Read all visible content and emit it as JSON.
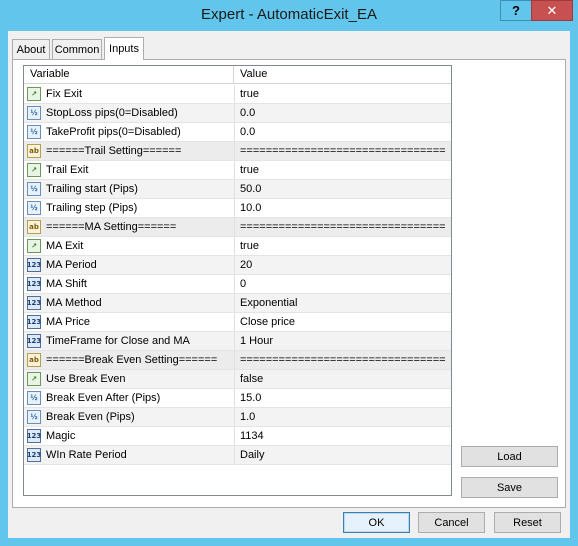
{
  "window": {
    "title": "Expert - AutomaticExit_EA",
    "help_label": "?",
    "close_label": "✕"
  },
  "tabs": [
    {
      "label": "About"
    },
    {
      "label": "Common"
    },
    {
      "label": "Inputs"
    }
  ],
  "grid": {
    "headers": {
      "variable": "Variable",
      "value": "Value"
    },
    "rows": [
      {
        "name": "Fix Exit",
        "value": "true",
        "type": "bool"
      },
      {
        "name": "StopLoss pips(0=Disabled)",
        "value": "0.0",
        "type": "double"
      },
      {
        "name": "TakeProfit pips(0=Disabled)",
        "value": "0.0",
        "type": "double"
      },
      {
        "name": "======Trail Setting======",
        "value": "================================",
        "type": "string"
      },
      {
        "name": "Trail Exit",
        "value": "true",
        "type": "bool"
      },
      {
        "name": "Trailing start (Pips)",
        "value": "50.0",
        "type": "double"
      },
      {
        "name": "Trailing step (Pips)",
        "value": "10.0",
        "type": "double"
      },
      {
        "name": "======MA Setting======",
        "value": "================================",
        "type": "string"
      },
      {
        "name": "MA Exit",
        "value": "true",
        "type": "bool"
      },
      {
        "name": "MA Period",
        "value": "20",
        "type": "int"
      },
      {
        "name": "MA Shift",
        "value": "0",
        "type": "int"
      },
      {
        "name": "MA Method",
        "value": "Exponential",
        "type": "int"
      },
      {
        "name": "MA Price",
        "value": "Close price",
        "type": "int"
      },
      {
        "name": "TimeFrame for Close and MA",
        "value": "1 Hour",
        "type": "int"
      },
      {
        "name": "======Break Even Setting======",
        "value": "================================",
        "type": "string"
      },
      {
        "name": "Use Break Even",
        "value": "false",
        "type": "bool"
      },
      {
        "name": "Break Even After (Pips)",
        "value": "15.0",
        "type": "double"
      },
      {
        "name": "Break Even (Pips)",
        "value": "1.0",
        "type": "double"
      },
      {
        "name": "Magic",
        "value": "1134",
        "type": "int"
      },
      {
        "name": "WIn Rate Period",
        "value": "Daily",
        "type": "int"
      }
    ]
  },
  "icons": {
    "bool": "boolean-icon",
    "double": "double-icon",
    "string": "string-icon",
    "int": "integer-icon"
  },
  "icon_glyphs": {
    "bool": "↗",
    "double": "½",
    "string": "ab",
    "int": "123"
  },
  "buttons": {
    "load": "Load",
    "save": "Save",
    "ok": "OK",
    "cancel": "Cancel",
    "reset": "Reset"
  }
}
